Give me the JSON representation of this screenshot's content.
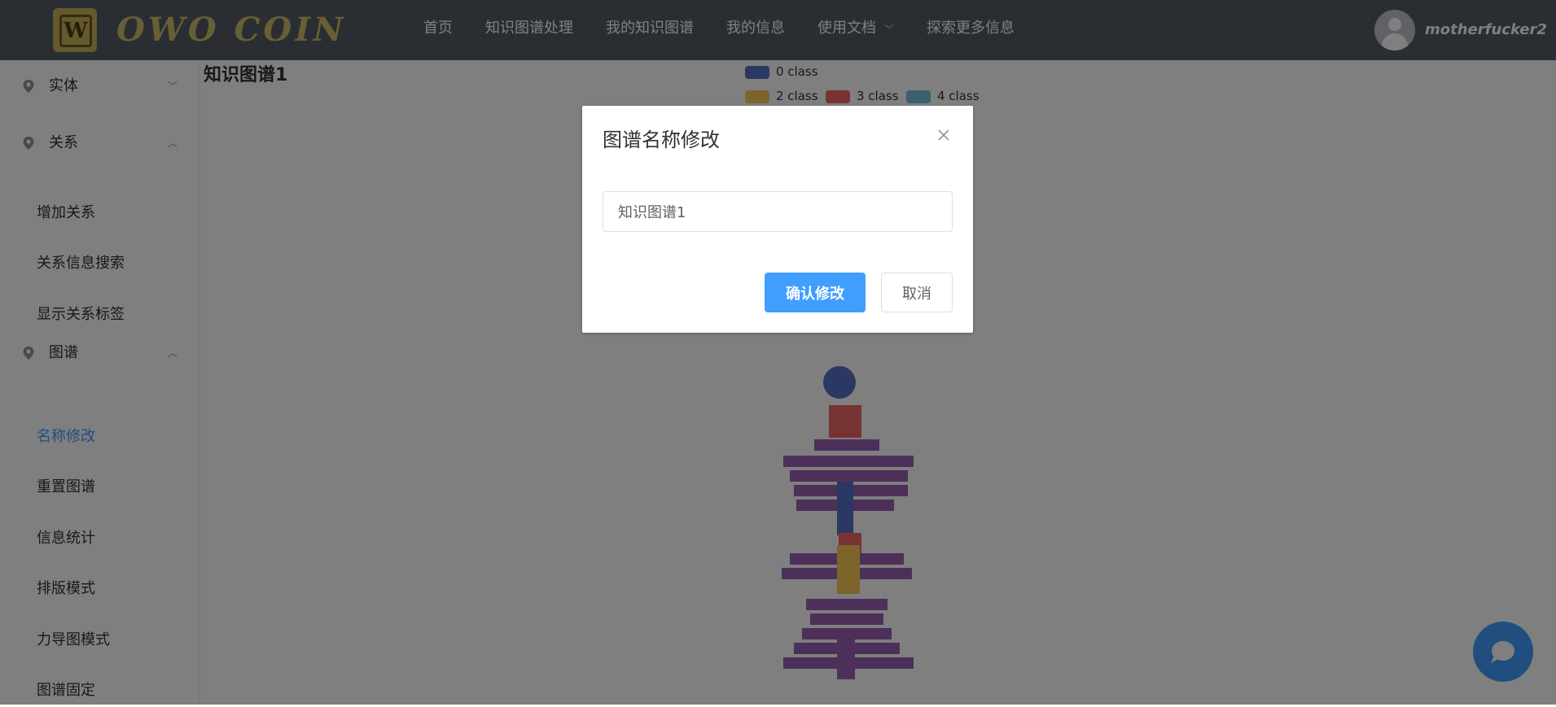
{
  "header": {
    "logo_letter": "W",
    "brand": "OWO COIN",
    "nav": [
      {
        "label": "首页"
      },
      {
        "label": "知识图谱处理"
      },
      {
        "label": "我的知识图谱"
      },
      {
        "label": "我的信息"
      },
      {
        "label": "使用文档",
        "has_dropdown": true
      },
      {
        "label": "探索更多信息"
      }
    ],
    "username": "motherfucker2"
  },
  "sidebar": {
    "groups": [
      {
        "label": "实体",
        "icon": "location-icon",
        "expanded": false,
        "items": []
      },
      {
        "label": "关系",
        "icon": "location-icon",
        "expanded": true,
        "items": [
          {
            "label": "增加关系"
          },
          {
            "label": "关系信息搜索"
          },
          {
            "label": "显示关系标签"
          }
        ]
      },
      {
        "label": "图谱",
        "icon": "location-icon",
        "expanded": true,
        "items": [
          {
            "label": "名称修改",
            "active": true
          },
          {
            "label": "重置图谱"
          },
          {
            "label": "信息统计"
          },
          {
            "label": "排版模式"
          },
          {
            "label": "力导图模式"
          },
          {
            "label": "图谱固定"
          }
        ]
      }
    ]
  },
  "main": {
    "graph_title": "知识图谱1",
    "legend": [
      {
        "label": "0 class",
        "color": "#5470c6"
      },
      {
        "label": "2 class",
        "color": "#fac858"
      },
      {
        "label": "3 class",
        "color": "#ee6666"
      },
      {
        "label": "4 class",
        "color": "#73c0de"
      }
    ]
  },
  "dialog": {
    "title": "图谱名称修改",
    "input_value": "知识图谱1",
    "confirm_label": "确认修改",
    "cancel_label": "取消"
  },
  "colors": {
    "header_bg": "#545c64",
    "accent": "#409eff",
    "active_text": "#409eff"
  }
}
